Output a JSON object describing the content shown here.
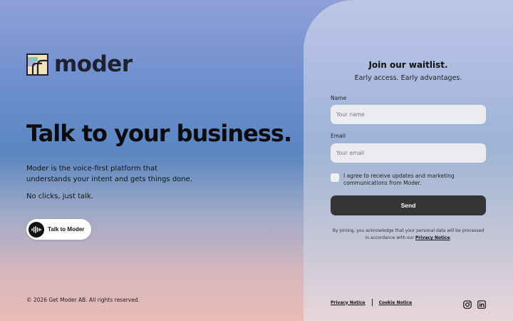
{
  "brand": {
    "name": "moder"
  },
  "hero": {
    "headline": "Talk to your business.",
    "description": "Moder is the voice-first platform that understands your intent and gets things done.",
    "tagline": "No clicks, just talk.",
    "talk_button": "Talk to Moder"
  },
  "footer": {
    "copyright": "© 2026 Get Moder AB. All rights reserved."
  },
  "waitlist": {
    "title": "Join our waitlist.",
    "subtitle": "Early access. Early advantages.",
    "name_label": "Name",
    "name_placeholder": "Your name",
    "email_label": "Email",
    "email_placeholder": "Your email",
    "consent_text": "I agree to receive updates and marketing communications from Moder.",
    "send_button": "Send",
    "fine_print_prefix": "By joining, you acknowledge that your personal data will be processed in accordance with our",
    "fine_print_link": "Privacy Notice",
    "fine_print_suffix": ".",
    "footer_links": [
      "Privacy Notice",
      "Cookie Notice"
    ]
  },
  "social": [
    "instagram-icon",
    "linkedin-icon"
  ]
}
